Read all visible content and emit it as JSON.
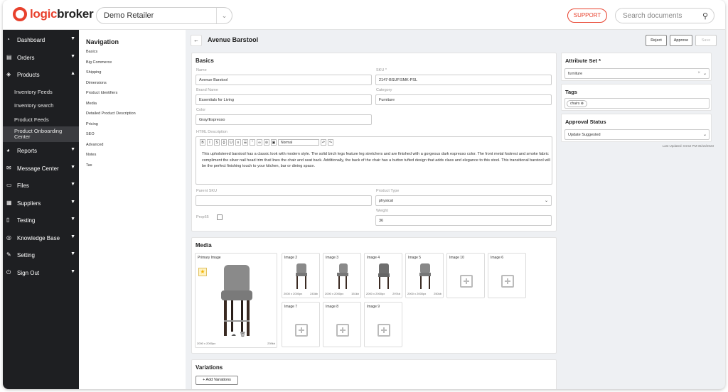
{
  "app": {
    "logo_text_a": "logic",
    "logo_text_b": "broker",
    "retailer": "Demo Retailer",
    "support": "SUPPORT",
    "search_placeholder": "Search documents"
  },
  "sidebar": {
    "items": [
      {
        "label": "Dashboard",
        "icon": "gauge-icon"
      },
      {
        "label": "Orders",
        "icon": "clipboard-icon"
      },
      {
        "label": "Products",
        "icon": "box-icon"
      },
      {
        "label": "Reports",
        "icon": "pie-icon"
      },
      {
        "label": "Message Center",
        "icon": "envelope-icon"
      },
      {
        "label": "Files",
        "icon": "folder-icon"
      },
      {
        "label": "Suppliers",
        "icon": "building-icon"
      },
      {
        "label": "Testing",
        "icon": "doc-icon"
      },
      {
        "label": "Knowledge Base",
        "icon": "globe-icon"
      },
      {
        "label": "Setting",
        "icon": "wrench-icon"
      },
      {
        "label": "Sign Out",
        "icon": "power-icon"
      }
    ],
    "product_subitems": [
      "Inventory Feeds",
      "Inventory search",
      "Product Feeds",
      "Product Onboarding Center"
    ]
  },
  "nav": {
    "title": "Navigation",
    "items": [
      "Basics",
      "Big Commerce",
      "Shipping",
      "Dimensions",
      "Product Identifiers",
      "Media",
      "Detailed Product Description",
      "Pricing",
      "SEO",
      "Advanced",
      "Notes",
      "Tax"
    ]
  },
  "header": {
    "title": "Avenue Barstool",
    "reject": "Reject",
    "approve": "Approve",
    "save": "Save"
  },
  "basics": {
    "title": "Basics",
    "name_label": "Name",
    "name_value": "Avenue Barstool",
    "sku_label": "SKU *",
    "sku_value": "2147-BSUP.SMK-PSL",
    "brand_label": "Brand Name",
    "brand_value": "Essentials for Living",
    "category_label": "Category",
    "category_value": "Furniture",
    "color_label": "Color",
    "color_value": "Gray/Espresso",
    "html_label": "HTML Description",
    "format_value": "Normal",
    "description": "This upholstered barstool has a classic look with modern style. The solid birch legs feature leg stretchers and are finished with a gorgeous dark espresso color. The front metal footrest and smoke fabric compliment the silver nail head trim that lines the chair and seat back. Additionally, the back of the chair has a button tufted design that adds class and elegance to this stool. This transitional barstool will be the perfect finishing touch to your kitchen, bar or dining space.",
    "parent_sku_label": "Parent SKU",
    "parent_sku_value": "",
    "product_type_label": "Product Type",
    "product_type_value": "physical",
    "prop65_label": "Prop65",
    "weight_label": "Weight",
    "weight_value": "36"
  },
  "media": {
    "title": "Media",
    "primary": {
      "label": "Primary Image",
      "dims": "2000 x 2000px",
      "size": "239kb"
    },
    "images": [
      {
        "label": "Image 2",
        "dims": "2000 x 2000px",
        "size": "243kb",
        "filled": true
      },
      {
        "label": "Image 3",
        "dims": "2000 x 2000px",
        "size": "151kb",
        "filled": true
      },
      {
        "label": "Image 4",
        "dims": "2000 x 2000px",
        "size": "297kb",
        "filled": true
      },
      {
        "label": "Image 5",
        "dims": "2000 x 2000px",
        "size": "250kb",
        "filled": true
      },
      {
        "label": "Image 10",
        "filled": false
      },
      {
        "label": "Image 6",
        "filled": false
      },
      {
        "label": "Image 7",
        "filled": false
      },
      {
        "label": "Image 8",
        "filled": false
      },
      {
        "label": "Image 9",
        "filled": false
      }
    ]
  },
  "variations": {
    "title": "Variations",
    "add": "+ Add Variations"
  },
  "right": {
    "attribute_set_title": "Attribute Set *",
    "attribute_set_value": "furniture",
    "tags_title": "Tags",
    "tag": "chairs",
    "approval_title": "Approval Status",
    "approval_value": "Update Suggested",
    "last_updated": "Last Updated: 04:52 PM 06/16/2023"
  },
  "colors": {
    "brand": "#e8412d",
    "sidebar": "#1e1f22"
  }
}
